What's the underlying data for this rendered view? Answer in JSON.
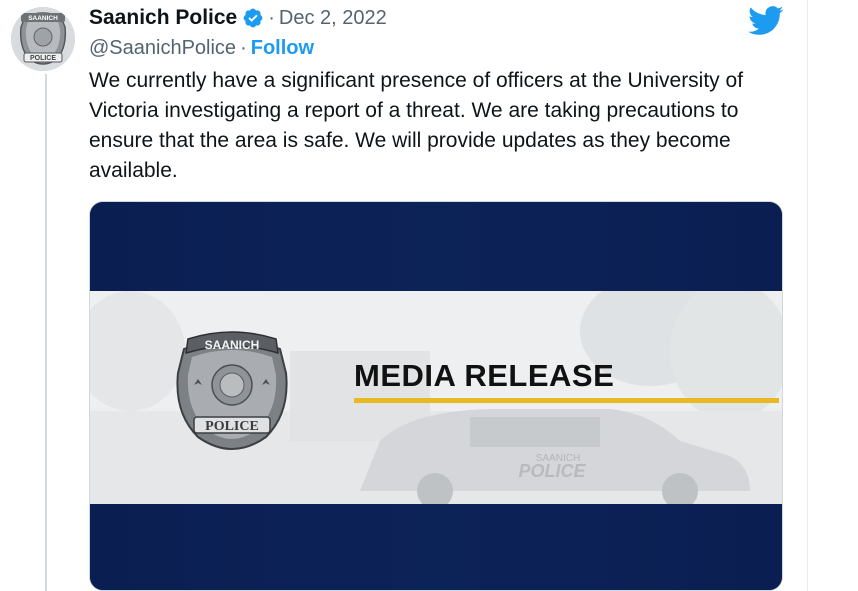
{
  "tweet": {
    "display_name": "Saanich Police",
    "separator": "·",
    "date": "Dec 2, 2022",
    "handle": "@SaanichPolice",
    "handle_separator": "·",
    "follow_label": "Follow",
    "text": "We currently have a significant presence of officers at the University of Victoria investigating a report of a threat. We are taking precautions to ensure that the area is safe. We will provide updates as they become available."
  },
  "avatar": {
    "badge_top_text": "SAANICH",
    "badge_bottom_text": "POLICE"
  },
  "media": {
    "title": "MEDIA RELEASE",
    "badge_top_text": "SAANICH",
    "badge_bottom_text": "POLICE",
    "car_text": "POLICE",
    "car_small_text": "SAANICH"
  },
  "colors": {
    "link_blue": "#1d9bf0",
    "banner_navy": "#0b1e52",
    "accent_yellow": "#e8b923"
  }
}
